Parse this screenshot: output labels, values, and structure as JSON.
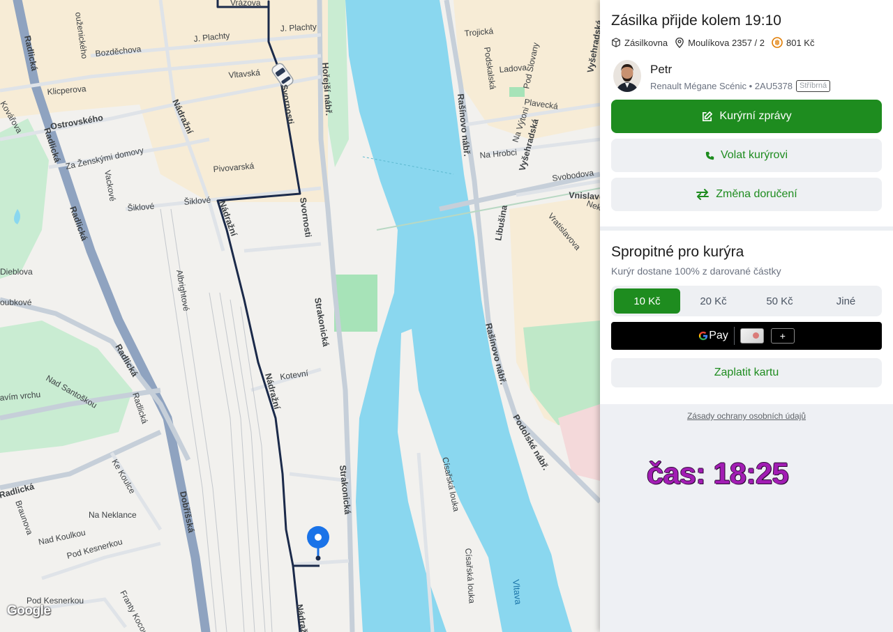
{
  "map": {
    "logo": "Google",
    "river_label": "Vltava",
    "streets": {
      "vrazova": "Vrázova",
      "j_plachty_1": "J. Plachty",
      "j_plachty_2": "J. Plachty",
      "bozdechova": "Bozděchova",
      "vltavska": "Vltavská",
      "klicperova": "Klicperova",
      "ostrovskeho": "Ostrovského",
      "nadrazni_1": "Nádražní",
      "nadrazni_2": "Nádražní",
      "nadrazni_3": "Nádražní",
      "nadrazni_4": "Nádražní",
      "za_zenskymi": "Za Ženskými domovy",
      "pivovarska": "Pivovarská",
      "siklove_1": "Šiklové",
      "siklove_2": "Šiklové",
      "vackove": "Vackové",
      "svornosti_1": "Svornosti",
      "svornosti_2": "Svornosti",
      "hofejsi": "Hořejší nábř.",
      "strakonicka_1": "Strakonická",
      "strakonicka_2": "Strakonická",
      "kotevni": "Kotevní",
      "radlicka_1": "Radlická",
      "radlicka_2": "Radlická",
      "radlicka_3": "Radlická",
      "radlicka_4": "Radlická",
      "radlicka_5": "Radlická",
      "radlicka_6": "Radlická",
      "albrightove": "Albrightové",
      "nad_santoskou": "Nad Santoškou",
      "pod_vrchu": "avím vrchu",
      "ke_koulce": "Ke Koulce",
      "dobrisska": "Dobříšská",
      "braunova": "Braunova",
      "na_neklance": "Na Neklance",
      "nad_koulkou": "Nad Koulkou",
      "pod_kesnerkou_1": "Pod Kesnerkou",
      "pod_kesnerkou_2": "Pod Kesnerkou",
      "franty_kocourka": "Franty Kocourka",
      "kovarova": "Kovářova",
      "dieblova": "Dieblova",
      "oubkove": "oubkové",
      "trojicka": "Trojická",
      "podskalska": "Podskalská",
      "ladova": "Ladova",
      "pod_slovany": "Pod Slovany",
      "vysehradska_1": "Vyšehradská",
      "vysehradska_2": "Vyšehradská",
      "plavecka": "Plavecká",
      "na_vytoni": "Na Výtoni",
      "na_hrobci": "Na Hrobci",
      "svobodova": "Svobodova",
      "vnislavova": "Vnislavova",
      "neklanova": "Nekl",
      "rasinovo_1": "Rašínovo nábř.",
      "rasinovo_2": "Rašínovo nábř.",
      "rasinovo_3": "Rašínovo nábř.",
      "libusina": "Libušina",
      "vratislavova": "Vratislavova",
      "podolske": "Podolské nábř.",
      "cisarska_1": "Císařská louka",
      "cisarska_2": "Císařská louka",
      "podbelohorska": "ouženického"
    }
  },
  "panel": {
    "eta": "Zásilka přijde kolem 19:10",
    "meta": {
      "carrier": "Zásilkovna",
      "address": "Moulíkova 2357 / 2",
      "price": "801 Kč"
    },
    "courier": {
      "name": "Petr",
      "car": "Renault Mégane Scénic • 2AU5378",
      "color_badge": "Stříbrná"
    },
    "buttons": {
      "messages": "Kurýrní zprávy",
      "call": "Volat kurýrovi",
      "change": "Změna doručení"
    },
    "tip": {
      "title": "Spropitné pro kurýra",
      "subtitle": "Kurýr dostane 100% z darované částky",
      "options": [
        "10 Kč",
        "20 Kč",
        "50 Kč",
        "Jiné"
      ],
      "selected_index": 0,
      "gpay_label": "Pay",
      "gpay_plus": "+",
      "pay_card": "Zaplatit kartu"
    },
    "privacy": "Zásady ochrany osobních údajů",
    "clock": "čas: 18:25"
  },
  "colors": {
    "accent_green": "#1e8c1f",
    "river": "#8ad7ef",
    "route": "#1b2a4a",
    "pin": "#1a73e8",
    "clock": "#a21db4"
  }
}
